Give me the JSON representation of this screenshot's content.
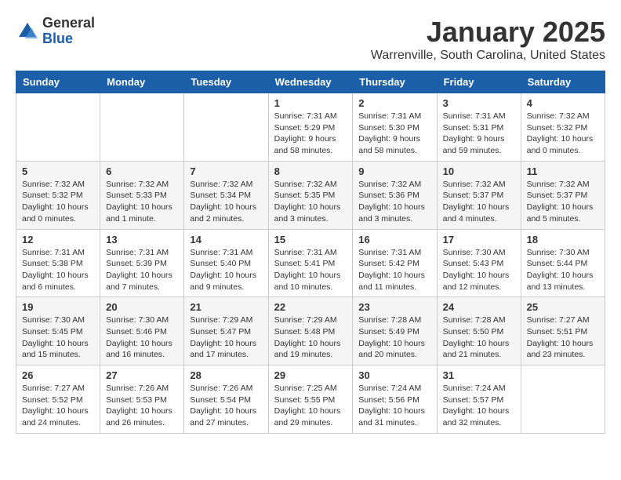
{
  "header": {
    "logo_general": "General",
    "logo_blue": "Blue",
    "month_title": "January 2025",
    "location": "Warrenville, South Carolina, United States"
  },
  "weekdays": [
    "Sunday",
    "Monday",
    "Tuesday",
    "Wednesday",
    "Thursday",
    "Friday",
    "Saturday"
  ],
  "weeks": [
    [
      {
        "day": "",
        "info": ""
      },
      {
        "day": "",
        "info": ""
      },
      {
        "day": "",
        "info": ""
      },
      {
        "day": "1",
        "info": "Sunrise: 7:31 AM\nSunset: 5:29 PM\nDaylight: 9 hours\nand 58 minutes."
      },
      {
        "day": "2",
        "info": "Sunrise: 7:31 AM\nSunset: 5:30 PM\nDaylight: 9 hours\nand 58 minutes."
      },
      {
        "day": "3",
        "info": "Sunrise: 7:31 AM\nSunset: 5:31 PM\nDaylight: 9 hours\nand 59 minutes."
      },
      {
        "day": "4",
        "info": "Sunrise: 7:32 AM\nSunset: 5:32 PM\nDaylight: 10 hours\nand 0 minutes."
      }
    ],
    [
      {
        "day": "5",
        "info": "Sunrise: 7:32 AM\nSunset: 5:32 PM\nDaylight: 10 hours\nand 0 minutes."
      },
      {
        "day": "6",
        "info": "Sunrise: 7:32 AM\nSunset: 5:33 PM\nDaylight: 10 hours\nand 1 minute."
      },
      {
        "day": "7",
        "info": "Sunrise: 7:32 AM\nSunset: 5:34 PM\nDaylight: 10 hours\nand 2 minutes."
      },
      {
        "day": "8",
        "info": "Sunrise: 7:32 AM\nSunset: 5:35 PM\nDaylight: 10 hours\nand 3 minutes."
      },
      {
        "day": "9",
        "info": "Sunrise: 7:32 AM\nSunset: 5:36 PM\nDaylight: 10 hours\nand 3 minutes."
      },
      {
        "day": "10",
        "info": "Sunrise: 7:32 AM\nSunset: 5:37 PM\nDaylight: 10 hours\nand 4 minutes."
      },
      {
        "day": "11",
        "info": "Sunrise: 7:32 AM\nSunset: 5:37 PM\nDaylight: 10 hours\nand 5 minutes."
      }
    ],
    [
      {
        "day": "12",
        "info": "Sunrise: 7:31 AM\nSunset: 5:38 PM\nDaylight: 10 hours\nand 6 minutes."
      },
      {
        "day": "13",
        "info": "Sunrise: 7:31 AM\nSunset: 5:39 PM\nDaylight: 10 hours\nand 7 minutes."
      },
      {
        "day": "14",
        "info": "Sunrise: 7:31 AM\nSunset: 5:40 PM\nDaylight: 10 hours\nand 9 minutes."
      },
      {
        "day": "15",
        "info": "Sunrise: 7:31 AM\nSunset: 5:41 PM\nDaylight: 10 hours\nand 10 minutes."
      },
      {
        "day": "16",
        "info": "Sunrise: 7:31 AM\nSunset: 5:42 PM\nDaylight: 10 hours\nand 11 minutes."
      },
      {
        "day": "17",
        "info": "Sunrise: 7:30 AM\nSunset: 5:43 PM\nDaylight: 10 hours\nand 12 minutes."
      },
      {
        "day": "18",
        "info": "Sunrise: 7:30 AM\nSunset: 5:44 PM\nDaylight: 10 hours\nand 13 minutes."
      }
    ],
    [
      {
        "day": "19",
        "info": "Sunrise: 7:30 AM\nSunset: 5:45 PM\nDaylight: 10 hours\nand 15 minutes."
      },
      {
        "day": "20",
        "info": "Sunrise: 7:30 AM\nSunset: 5:46 PM\nDaylight: 10 hours\nand 16 minutes."
      },
      {
        "day": "21",
        "info": "Sunrise: 7:29 AM\nSunset: 5:47 PM\nDaylight: 10 hours\nand 17 minutes."
      },
      {
        "day": "22",
        "info": "Sunrise: 7:29 AM\nSunset: 5:48 PM\nDaylight: 10 hours\nand 19 minutes."
      },
      {
        "day": "23",
        "info": "Sunrise: 7:28 AM\nSunset: 5:49 PM\nDaylight: 10 hours\nand 20 minutes."
      },
      {
        "day": "24",
        "info": "Sunrise: 7:28 AM\nSunset: 5:50 PM\nDaylight: 10 hours\nand 21 minutes."
      },
      {
        "day": "25",
        "info": "Sunrise: 7:27 AM\nSunset: 5:51 PM\nDaylight: 10 hours\nand 23 minutes."
      }
    ],
    [
      {
        "day": "26",
        "info": "Sunrise: 7:27 AM\nSunset: 5:52 PM\nDaylight: 10 hours\nand 24 minutes."
      },
      {
        "day": "27",
        "info": "Sunrise: 7:26 AM\nSunset: 5:53 PM\nDaylight: 10 hours\nand 26 minutes."
      },
      {
        "day": "28",
        "info": "Sunrise: 7:26 AM\nSunset: 5:54 PM\nDaylight: 10 hours\nand 27 minutes."
      },
      {
        "day": "29",
        "info": "Sunrise: 7:25 AM\nSunset: 5:55 PM\nDaylight: 10 hours\nand 29 minutes."
      },
      {
        "day": "30",
        "info": "Sunrise: 7:24 AM\nSunset: 5:56 PM\nDaylight: 10 hours\nand 31 minutes."
      },
      {
        "day": "31",
        "info": "Sunrise: 7:24 AM\nSunset: 5:57 PM\nDaylight: 10 hours\nand 32 minutes."
      },
      {
        "day": "",
        "info": ""
      }
    ]
  ]
}
